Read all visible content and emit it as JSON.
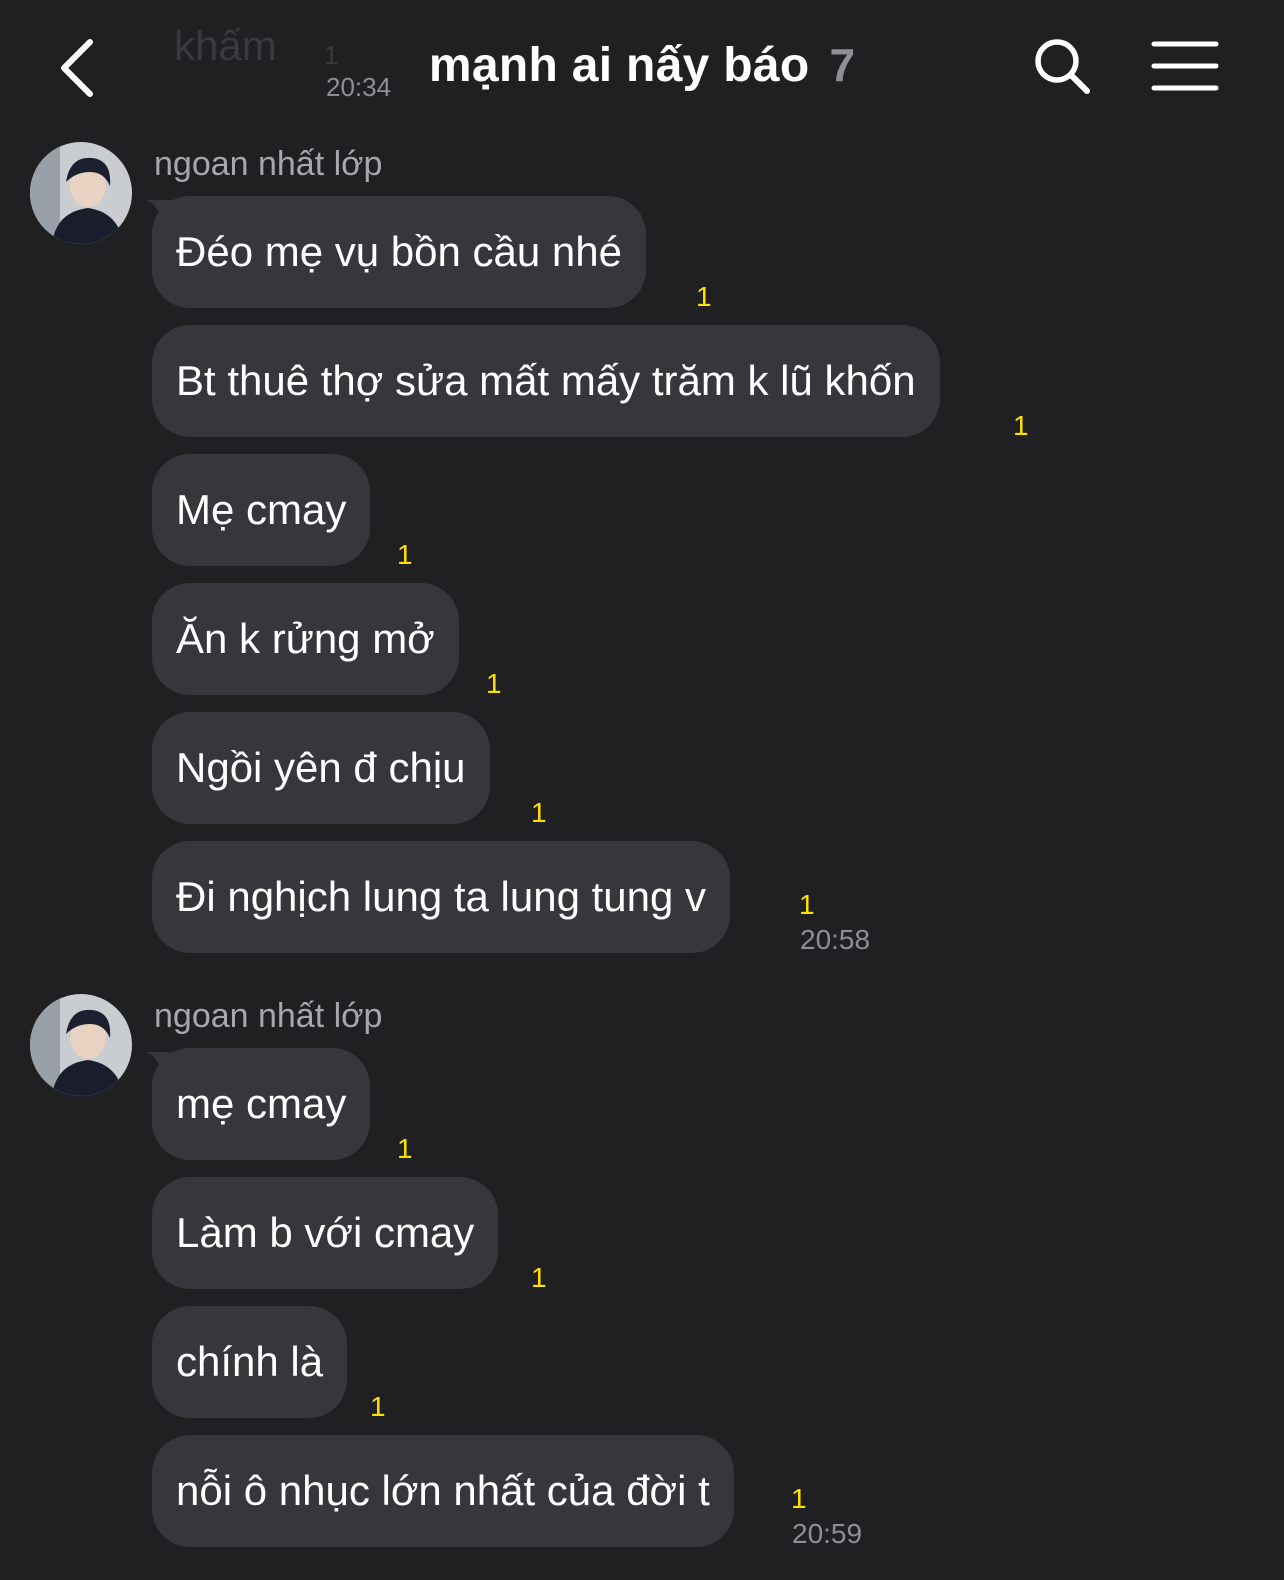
{
  "colors": {
    "background": "#202023",
    "bubble": "#37373b",
    "unread": "#ffe100",
    "muted": "#8e8e93"
  },
  "header": {
    "back_icon": "chevron-left-icon",
    "title": "mạnh ai nấy báo",
    "member_count": "7",
    "search_icon": "search-icon",
    "menu_icon": "hamburger-menu-icon",
    "ghost_name": "khấm",
    "ghost_count": "1",
    "ghost_time": "20:34"
  },
  "groups": [
    {
      "sender": "ngoan nhất lớp",
      "avatar_icon": "user-avatar",
      "messages": [
        {
          "text": "Đéo mẹ vụ bồn cầu nhé",
          "unread": "1"
        },
        {
          "text": "Bt thuê thợ sửa mất mấy trăm k lũ khốn",
          "unread": "1"
        },
        {
          "text": "Mẹ cmay",
          "unread": "1"
        },
        {
          "text": "Ăn k rửng mở",
          "unread": "1"
        },
        {
          "text": "Ngồi yên đ chịu",
          "unread": "1"
        },
        {
          "text": "Đi nghịch lung ta lung tung v",
          "unread": "1",
          "time": "20:58"
        }
      ]
    },
    {
      "sender": "ngoan nhất lớp",
      "avatar_icon": "user-avatar",
      "messages": [
        {
          "text": "mẹ cmay",
          "unread": "1"
        },
        {
          "text": "Làm b với cmay",
          "unread": "1"
        },
        {
          "text": "chính là",
          "unread": "1"
        },
        {
          "text": "nỗi ô nhục lớn nhất của đời t",
          "unread": "1",
          "time": "20:59"
        }
      ]
    }
  ]
}
